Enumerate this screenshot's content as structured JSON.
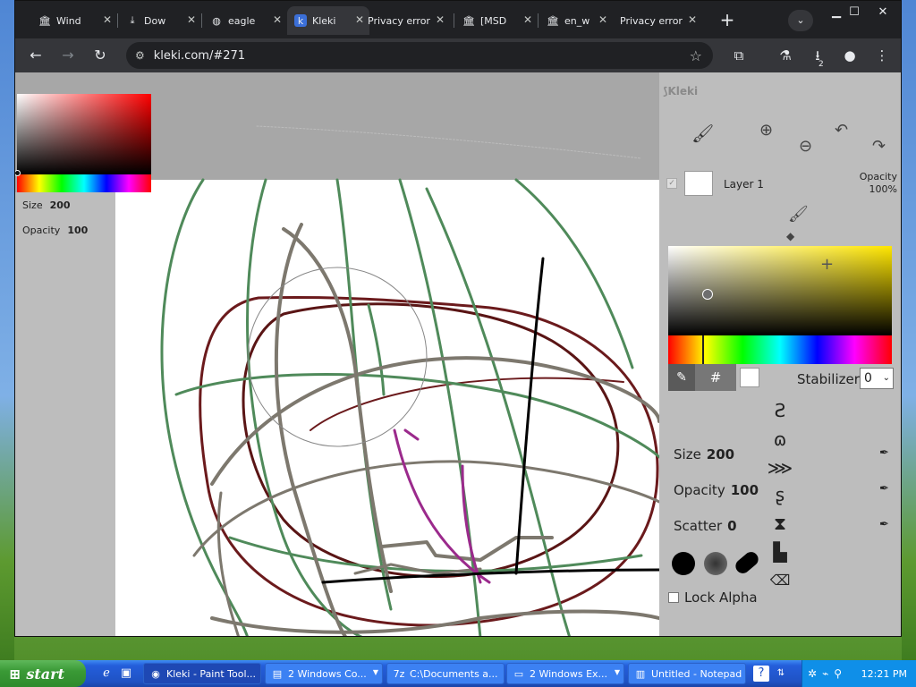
{
  "browser": {
    "tabs": [
      {
        "icon": "museum-icon",
        "label": "Wind"
      },
      {
        "icon": "download-icon",
        "label": "Dow"
      },
      {
        "icon": "globe-icon",
        "label": "eagle"
      },
      {
        "icon": "kleki-icon",
        "label": "Kleki",
        "active": true
      },
      {
        "icon": "",
        "label": "Privacy error"
      },
      {
        "icon": "museum-icon",
        "label": "[MSD"
      },
      {
        "icon": "museum-icon",
        "label": "en_w"
      },
      {
        "icon": "",
        "label": "Privacy error"
      }
    ],
    "url": "kleki.com/#271",
    "download_badge": "2"
  },
  "kleki": {
    "logo": "Kleki",
    "left_panel": {
      "size_label": "Size",
      "size_value": "200",
      "opacity_label": "Opacity",
      "opacity_value": "100"
    },
    "layer": {
      "name": "Layer 1",
      "opacity_label": "Opacity",
      "opacity_value": "100%"
    },
    "stabilizer_label": "Stabilizer",
    "stabilizer_value": "0",
    "hex_label": "#",
    "brush": {
      "size_label": "Size",
      "size_value": "200",
      "opacity_label": "Opacity",
      "opacity_value": "100",
      "scatter_label": "Scatter",
      "scatter_value": "0"
    },
    "lock_alpha_label": "Lock Alpha",
    "colors": {
      "primary": "#ffffff",
      "hue_picker": "#ffe600"
    }
  },
  "taskbar": {
    "start_label": "start",
    "tasks": [
      {
        "label": "Kleki - Paint Tool...",
        "icon": "chrome-icon",
        "active": true
      },
      {
        "label": "2 Windows Co...",
        "icon": "cmd-icon",
        "group": true
      },
      {
        "label": "C:\\Documents a...",
        "icon": "7zip-icon"
      },
      {
        "label": "2 Windows Ex...",
        "icon": "folder-icon",
        "group": true
      },
      {
        "label": "Untitled - Notepad",
        "icon": "notepad-icon"
      }
    ],
    "clock": "12:21 PM"
  }
}
